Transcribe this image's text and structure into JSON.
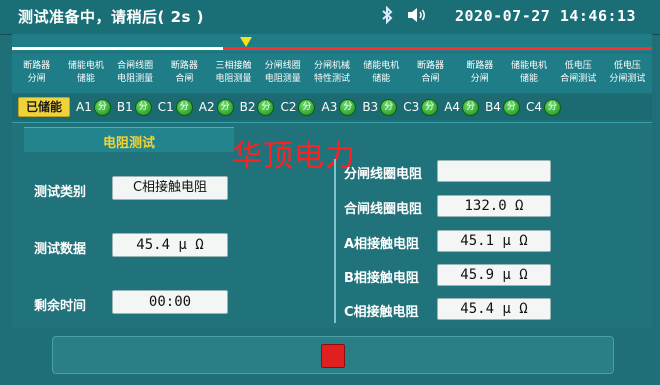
{
  "header": {
    "title": "测试准备中，请稍后( 2s )",
    "datetime": "2020-07-27  14:46:13",
    "icons": [
      "bluetooth-icon",
      "speaker-icon"
    ]
  },
  "progress": {
    "completed_fraction": 0.33
  },
  "steps": [
    {
      "line1": "断路器",
      "line2": "分闸"
    },
    {
      "line1": "储能电机",
      "line2": "储能"
    },
    {
      "line1": "合闸线圈",
      "line2": "电阻测量"
    },
    {
      "line1": "断路器",
      "line2": "合闸"
    },
    {
      "line1": "三相接触",
      "line2": "电阻测量"
    },
    {
      "line1": "分闸线圈",
      "line2": "电阻测量"
    },
    {
      "line1": "分闸机械",
      "line2": "特性测试"
    },
    {
      "line1": "储能电机",
      "line2": "储能"
    },
    {
      "line1": "断路器",
      "line2": "合闸"
    },
    {
      "line1": "断路器",
      "line2": "分闸"
    },
    {
      "line1": "储能电机",
      "line2": "储能"
    },
    {
      "line1": "低电压",
      "line2": "合闸测试"
    },
    {
      "line1": "低电压",
      "line2": "分闸测试"
    }
  ],
  "status": {
    "stored_label": "已储能",
    "switches": [
      {
        "label": "A1",
        "state": "分"
      },
      {
        "label": "B1",
        "state": "分"
      },
      {
        "label": "C1",
        "state": "分"
      },
      {
        "label": "A2",
        "state": "分"
      },
      {
        "label": "B2",
        "state": "分"
      },
      {
        "label": "C2",
        "state": "分"
      },
      {
        "label": "A3",
        "state": "分"
      },
      {
        "label": "B3",
        "state": "分"
      },
      {
        "label": "C3",
        "state": "分"
      },
      {
        "label": "A4",
        "state": "分"
      },
      {
        "label": "B4",
        "state": "分"
      },
      {
        "label": "C4",
        "state": "分"
      }
    ]
  },
  "panel": {
    "tab_label": "电阻测试",
    "watermark": "华顶电力",
    "left": {
      "category_label": "测试类别",
      "category_value": "C相接触电阻",
      "data_label": "测试数据",
      "data_value": "45.4  μ Ω",
      "time_label": "剩余时间",
      "time_value": "00:00"
    },
    "right": {
      "open_coil_label": "分闸线圈电阻",
      "open_coil_value": "",
      "close_coil_label": "合闸线圈电阻",
      "close_coil_value": "132.0  Ω",
      "a_label": "A相接触电阻",
      "a_value": "45.1  μ Ω",
      "b_label": "B相接触电阻",
      "b_value": "45.9  μ Ω",
      "c_label": "C相接触电阻",
      "c_value": "45.4  μ Ω"
    }
  },
  "colors": {
    "background": "#1f6f78",
    "accent_yellow": "#f0d23a",
    "progress_red": "#ff2d2d",
    "stop_red": "#e02020",
    "watermark_red": "#ff2020",
    "indicator_green": "#2fae2f"
  }
}
